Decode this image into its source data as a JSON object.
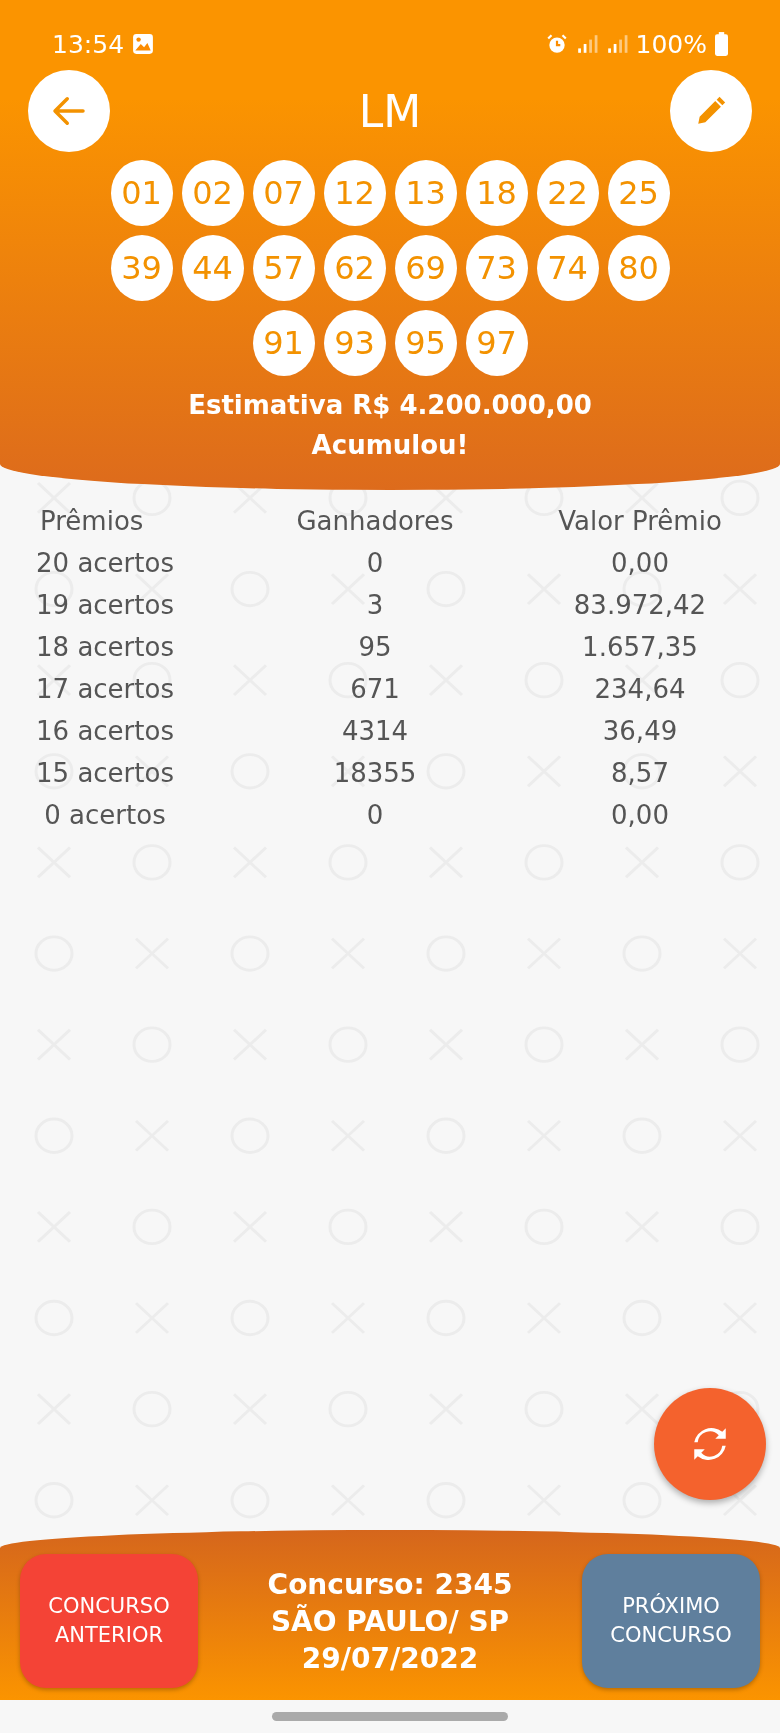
{
  "status_bar": {
    "time": "13:54",
    "battery": "100%"
  },
  "header": {
    "title": "LM"
  },
  "numbers": [
    "01",
    "02",
    "07",
    "12",
    "13",
    "18",
    "22",
    "25",
    "39",
    "44",
    "57",
    "62",
    "69",
    "73",
    "74",
    "80",
    "91",
    "93",
    "95",
    "97"
  ],
  "estimate": "Estimativa R$ 4.200.000,00",
  "note": "Acumulou!",
  "table": {
    "columns": [
      "Prêmios",
      "Ganhadores",
      "Valor Prêmio"
    ],
    "rows": [
      [
        "20 acertos",
        "0",
        "0,00"
      ],
      [
        "19 acertos",
        "3",
        "83.972,42"
      ],
      [
        "18 acertos",
        "95",
        "1.657,35"
      ],
      [
        "17 acertos",
        "671",
        "234,64"
      ],
      [
        "16 acertos",
        "4314",
        "36,49"
      ],
      [
        "15 acertos",
        "18355",
        "8,57"
      ],
      [
        "0 acertos",
        "0",
        "0,00"
      ]
    ]
  },
  "footer": {
    "prev_button": "CONCURSO ANTERIOR",
    "next_button": "PRÓXIMO CONCURSO",
    "contest": "Concurso: 2345",
    "place": "SÃO PAULO/ SP",
    "date": "29/07/2022"
  }
}
